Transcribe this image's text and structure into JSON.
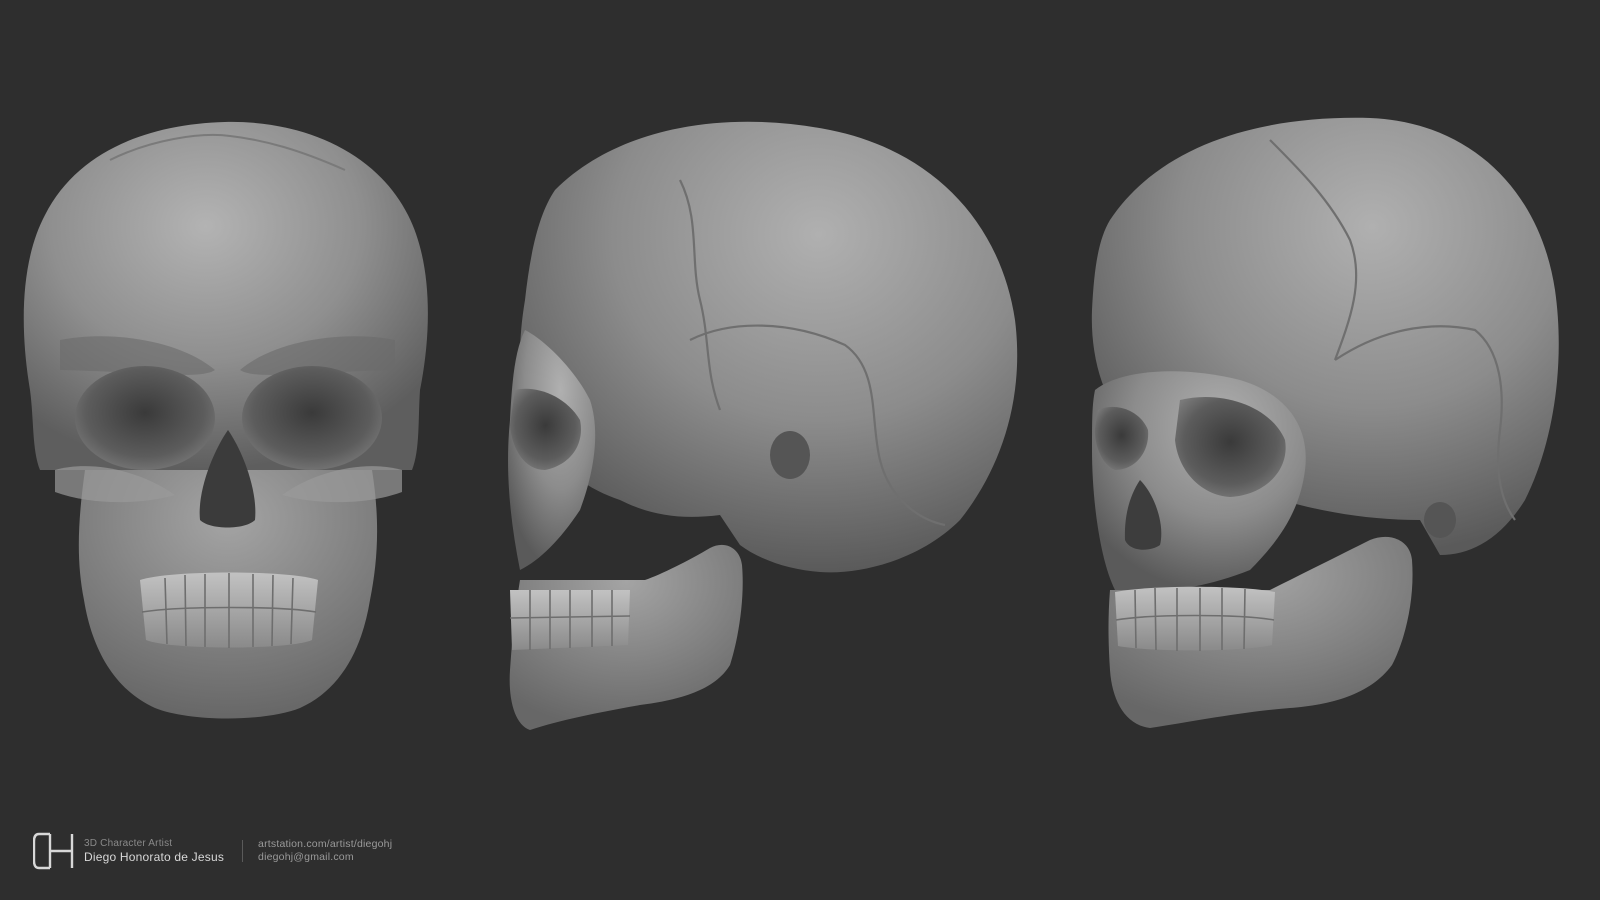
{
  "background_color": "#2e2e2e",
  "artwork": {
    "subject": "skull-sculpt",
    "views": [
      "front-view",
      "side-view",
      "three-quarter-view"
    ],
    "material_color": "#8e8e8e"
  },
  "credit": {
    "logo_icon": "dh-monogram-icon",
    "role": "3D Character Artist",
    "name": "Diego Honorato de Jesus",
    "artstation": "artstation.com/artist/diegohj",
    "email": "diegohj@gmail.com"
  }
}
